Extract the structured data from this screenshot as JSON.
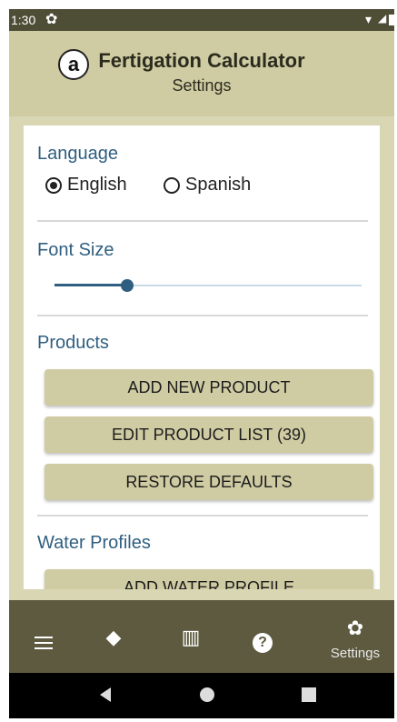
{
  "status_bar": {
    "time": "1:30",
    "icons": [
      "gear-icon",
      "wifi-icon",
      "signal-icon",
      "battery-icon"
    ]
  },
  "header": {
    "badge": "a",
    "title": "Fertigation Calculator",
    "subtitle": "Settings"
  },
  "language": {
    "title": "Language",
    "options": [
      {
        "label": "English",
        "selected": true
      },
      {
        "label": "Spanish",
        "selected": false
      }
    ]
  },
  "font_size": {
    "title": "Font Size",
    "slider_fraction": 0.23
  },
  "products": {
    "title": "Products",
    "buttons": [
      "ADD NEW PRODUCT",
      "EDIT PRODUCT LIST (39)",
      "RESTORE DEFAULTS"
    ]
  },
  "water_profiles": {
    "title": "Water Profiles",
    "button": "ADD WATER PROFILE"
  },
  "bottom_nav": {
    "items": [
      {
        "icon": "menu-icon"
      },
      {
        "icon": "layers-icon"
      },
      {
        "icon": "book-icon"
      },
      {
        "icon": "help-icon"
      },
      {
        "icon": "gear-icon",
        "label": "Settings"
      }
    ]
  },
  "colors": {
    "header_bg": "#cfcca3",
    "accent": "#2f5f80",
    "nav_bg": "#5d5a3f"
  }
}
